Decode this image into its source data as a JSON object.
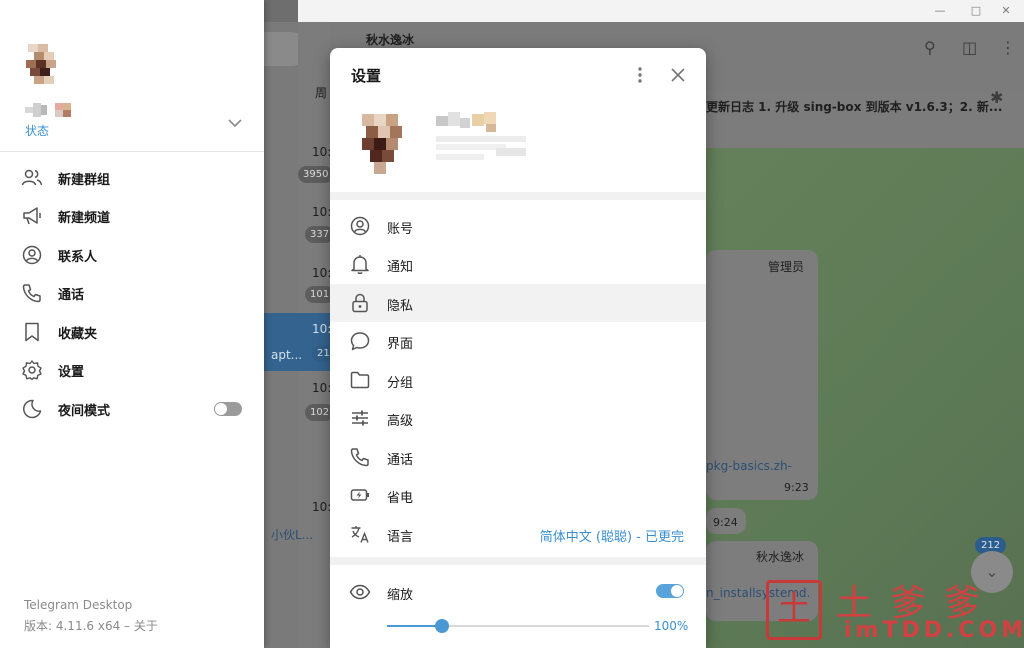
{
  "window": {
    "icons": [
      "minimize-icon",
      "maximize-icon",
      "close-icon"
    ]
  },
  "background": {
    "chat_title": "秋水逸冰",
    "pinned_text": "更新日志 1. 升级 sing-box 到版本 v1.6.3；2. 新...",
    "list_times": [
      "周",
      "10:",
      "10:",
      "10:",
      "10:",
      "10:",
      "10:"
    ],
    "list_badges": [
      "3950",
      "337",
      "101",
      "21",
      "102"
    ],
    "list_snippets": [
      "apt...",
      "小伙L..."
    ],
    "message_sender_1": "管理员",
    "message_link_1": "pkg-basics.zh-",
    "message_time_1": "9:23",
    "message_time_2": "9:24",
    "message_sender_2": "秋水逸冰",
    "message_link_2": "n_installsystemd.",
    "unread_count": "212",
    "watermark_cn": "土爹爹",
    "watermark_en": "imTDD.COM",
    "watermark_box": "土"
  },
  "drawer": {
    "status_label": "状态",
    "menu": [
      {
        "label": "新建群组",
        "icon": "new-group-icon"
      },
      {
        "label": "新建频道",
        "icon": "new-channel-icon"
      },
      {
        "label": "联系人",
        "icon": "contacts-icon"
      },
      {
        "label": "通话",
        "icon": "calls-icon"
      },
      {
        "label": "收藏夹",
        "icon": "saved-messages-icon"
      },
      {
        "label": "设置",
        "icon": "settings-icon"
      },
      {
        "label": "夜间模式",
        "icon": "night-mode-icon"
      }
    ],
    "night_mode_on": false,
    "app_name": "Telegram Desktop",
    "version": "版本: 4.11.6 x64 – 关于"
  },
  "dialog": {
    "title": "设置",
    "items": [
      {
        "label": "账号",
        "icon": "account-icon"
      },
      {
        "label": "通知",
        "icon": "bell-icon"
      },
      {
        "label": "隐私",
        "icon": "lock-icon"
      },
      {
        "label": "界面",
        "icon": "chat-bubble-icon"
      },
      {
        "label": "分组",
        "icon": "folder-icon"
      },
      {
        "label": "高级",
        "icon": "sliders-icon"
      },
      {
        "label": "通话",
        "icon": "phone-icon"
      },
      {
        "label": "省电",
        "icon": "battery-icon"
      },
      {
        "label": "语言",
        "icon": "translate-icon"
      }
    ],
    "language_value": "简体中文 (聪聪) - 已更完",
    "zoom_label": "缩放",
    "zoom_enabled": true,
    "zoom_value": "100%",
    "zoom_fraction": 0.21,
    "colors": {
      "accent": "#3a8fd0",
      "toggle": "#58a3db"
    }
  }
}
